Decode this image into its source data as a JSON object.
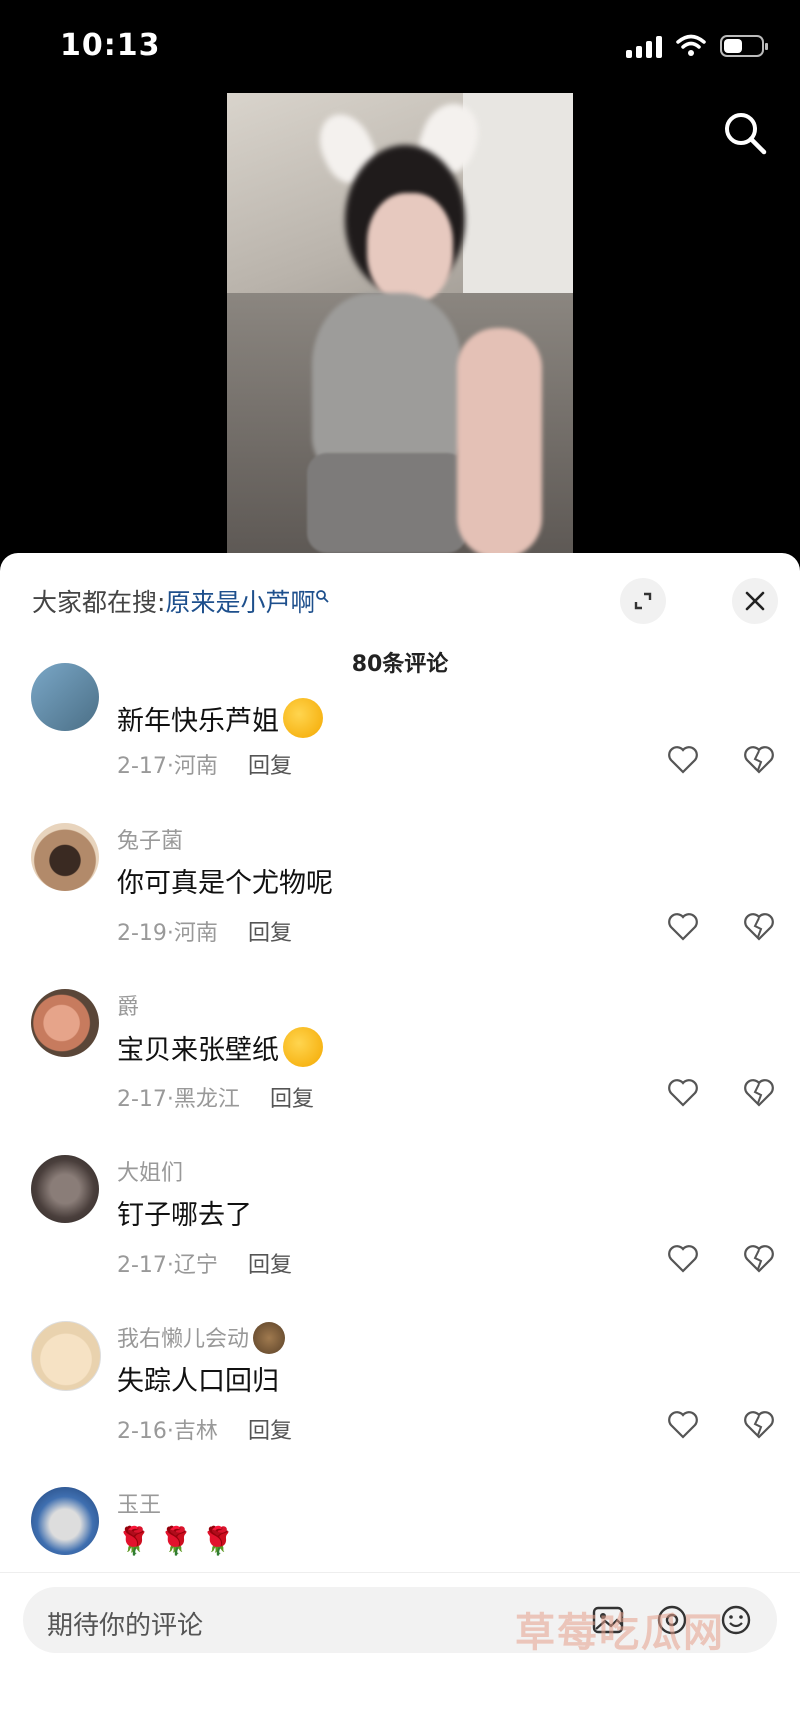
{
  "status": {
    "time": "10:13"
  },
  "sheet": {
    "hot_search_prefix": "大家都在搜:",
    "hot_search_term": "原来是小芦啊",
    "comment_count": "80条评论"
  },
  "comments": [
    {
      "username": "",
      "text": "新年快乐芦姐",
      "date": "2-17·河南",
      "reply": "回复"
    },
    {
      "username": "兔子菌",
      "text": "你可真是个尤物呢",
      "date": "2-19·河南",
      "reply": "回复"
    },
    {
      "username": "爵",
      "text": "宝贝来张壁纸",
      "date": "2-17·黑龙江",
      "reply": "回复"
    },
    {
      "username": "大姐们",
      "text": "钉子哪去了",
      "date": "2-17·辽宁",
      "reply": "回复"
    },
    {
      "username": "我右懒儿会动",
      "text": "失踪人口回归",
      "date": "2-16·吉林",
      "reply": "回复"
    },
    {
      "username": "玉王",
      "text": "🌹 🌹 🌹",
      "date": "",
      "reply": ""
    }
  ],
  "input": {
    "placeholder": "期待你的评论"
  },
  "watermark": "草莓吃瓜网"
}
